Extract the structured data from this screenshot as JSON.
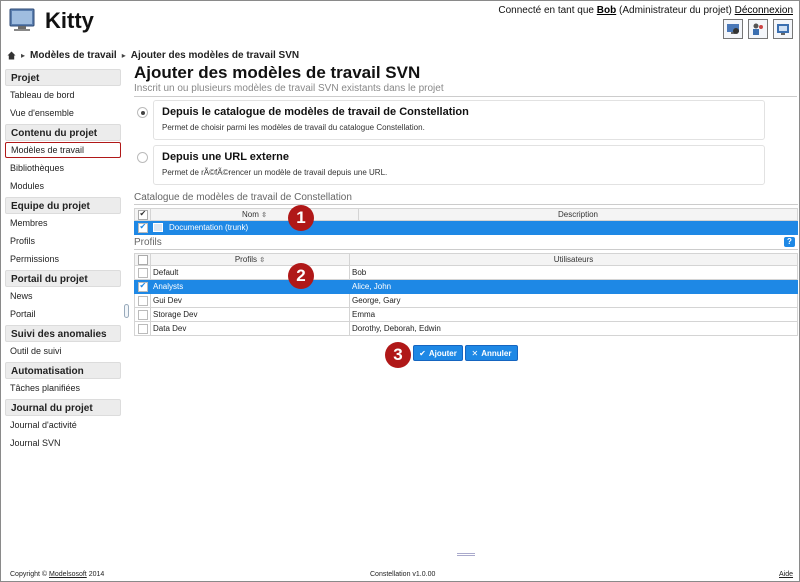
{
  "app": {
    "title": "Kitty"
  },
  "user": {
    "prefix": "Connecté en tant que",
    "name": "Bob",
    "role": "(Administrateur du projet)",
    "logout": "Déconnexion"
  },
  "breadcrumb": [
    "Modèles de travail",
    "Ajouter des modèles de travail SVN"
  ],
  "sidebar": {
    "sections": [
      {
        "title": "Projet",
        "items": [
          "Tableau de bord",
          "Vue d'ensemble"
        ]
      },
      {
        "title": "Contenu du projet",
        "items": [
          "Modèles de travail",
          "Bibliothèques",
          "Modules"
        ]
      },
      {
        "title": "Equipe du projet",
        "items": [
          "Membres",
          "Profils",
          "Permissions"
        ]
      },
      {
        "title": "Portail du projet",
        "items": [
          "News",
          "Portail"
        ]
      },
      {
        "title": "Suivi des anomalies",
        "items": [
          "Outil de suivi"
        ]
      },
      {
        "title": "Automatisation",
        "items": [
          "Tâches planifiées"
        ]
      },
      {
        "title": "Journal du projet",
        "items": [
          "Journal d'activité",
          "Journal SVN"
        ]
      }
    ],
    "active_item": "Modèles de travail"
  },
  "main": {
    "title": "Ajouter des modèles de travail SVN",
    "subtitle": "Inscrit un ou plusieurs modèles de travail SVN existants dans le projet",
    "options": [
      {
        "title": "Depuis le catalogue de modèles de travail de Constellation",
        "desc": "Permet de choisir parmi les modèles de travail du catalogue Constellation.",
        "checked": true
      },
      {
        "title": "Depuis une URL externe",
        "desc": "Permet de rÃ©fÃ©rencer un modèle de travail depuis une URL.",
        "checked": false
      }
    ],
    "catalog": {
      "title": "Catalogue de modèles de travail de Constellation",
      "columns": [
        "Nom",
        "Description"
      ],
      "rows": [
        {
          "name": "Documentation (trunk)",
          "description": "",
          "selected": true
        }
      ]
    },
    "profiles": {
      "title": "Profils",
      "help": "?",
      "columns": [
        "Profils",
        "Utilisateurs"
      ],
      "rows": [
        {
          "profile": "Default",
          "users": "Bob",
          "selected": false
        },
        {
          "profile": "Analysts",
          "users": "Alice, John",
          "selected": true
        },
        {
          "profile": "Gui Dev",
          "users": "George, Gary",
          "selected": false
        },
        {
          "profile": "Storage Dev",
          "users": "Emma",
          "selected": false
        },
        {
          "profile": "Data Dev",
          "users": "Dorothy, Deborah, Edwin",
          "selected": false
        }
      ]
    },
    "buttons": {
      "add": "Ajouter",
      "cancel": "Annuler"
    }
  },
  "steps": [
    "1",
    "2",
    "3"
  ],
  "footer": {
    "copyright": "Copyright ©",
    "company": "Modelsosoft",
    "year": "2014",
    "version": "Constellation v1.0.00",
    "help": "Aide"
  },
  "colors": {
    "accent": "#1e88e5",
    "step": "#b01818"
  }
}
